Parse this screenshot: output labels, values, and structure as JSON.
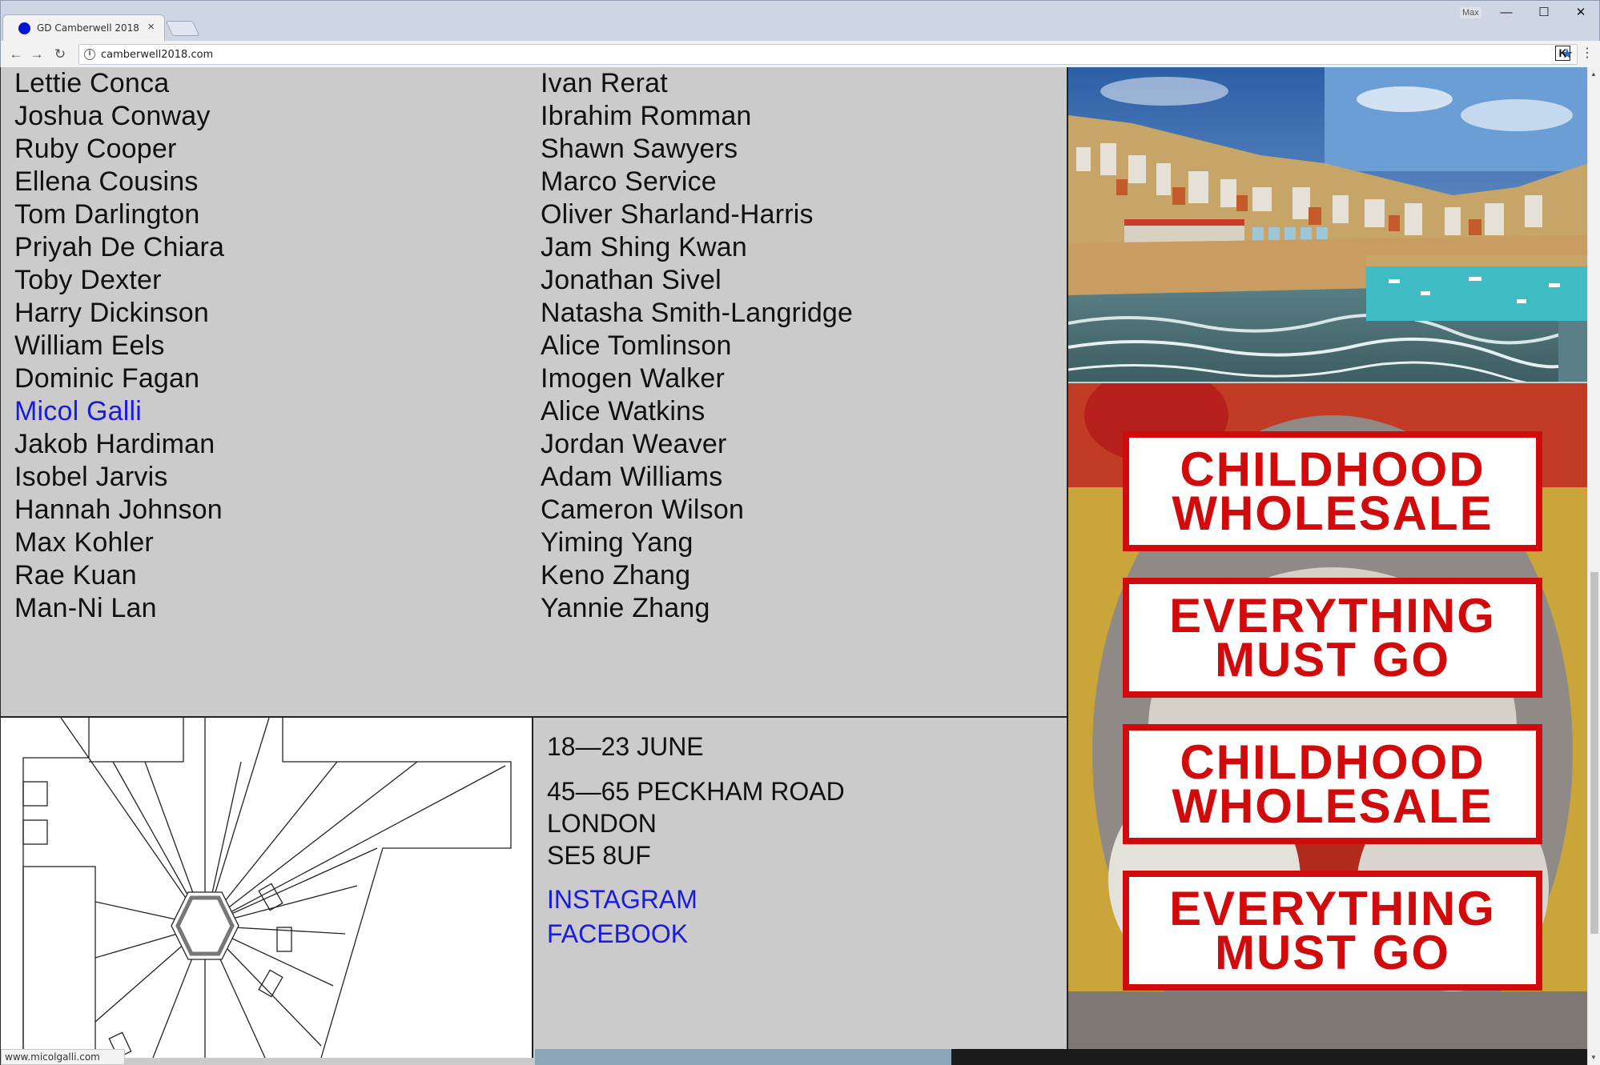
{
  "browser": {
    "tab_title": "GD Camberwell 2018",
    "tab_close": "×",
    "user_label": "Max",
    "url": "camberwell2018.com",
    "status_url": "www.micolgalli.com",
    "minimize": "—",
    "maximize": "☐",
    "close": "✕"
  },
  "students": {
    "column1": [
      {
        "name": "Lettie Conca"
      },
      {
        "name": "Joshua Conway"
      },
      {
        "name": "Ruby Cooper"
      },
      {
        "name": "Ellena Cousins"
      },
      {
        "name": "Tom Darlington"
      },
      {
        "name": "Priyah De Chiara"
      },
      {
        "name": "Toby Dexter"
      },
      {
        "name": "Harry Dickinson"
      },
      {
        "name": "William Eels"
      },
      {
        "name": "Dominic Fagan"
      },
      {
        "name": "Micol Galli"
      },
      {
        "name": "Jakob Hardiman"
      },
      {
        "name": "Isobel Jarvis"
      },
      {
        "name": "Hannah Johnson"
      },
      {
        "name": "Max Kohler"
      },
      {
        "name": "Rae Kuan"
      },
      {
        "name": "Man-Ni Lan"
      }
    ],
    "column2": [
      {
        "name": "Ivan Rerat"
      },
      {
        "name": "Ibrahim Romman"
      },
      {
        "name": "Shawn Sawyers"
      },
      {
        "name": "Marco Service"
      },
      {
        "name": "Oliver Sharland-Harris"
      },
      {
        "name": "Jam Shing Kwan"
      },
      {
        "name": "Jonathan Sivel"
      },
      {
        "name": "Natasha Smith-Langridge"
      },
      {
        "name": "Alice Tomlinson"
      },
      {
        "name": "Imogen Walker"
      },
      {
        "name": "Alice Watkins"
      },
      {
        "name": "Jordan Weaver"
      },
      {
        "name": "Adam Williams"
      },
      {
        "name": "Cameron Wilson"
      },
      {
        "name": "Yiming Yang"
      },
      {
        "name": "Keno Zhang"
      },
      {
        "name": "Yannie Zhang"
      }
    ],
    "hovered_name": "Micol Galli"
  },
  "event": {
    "dates": "18—23 JUNE",
    "address_line1": "45—65 PECKHAM ROAD",
    "address_line2": "LONDON",
    "address_line3": "SE5 8UF",
    "instagram": "INSTAGRAM",
    "facebook": "FACEBOOK"
  },
  "poster": {
    "sign1_line1": "CHILDHOOD",
    "sign1_line2": "WHOLESALE",
    "sign2_line1": "EVERYTHING",
    "sign2_line2": "MUST GO",
    "sign3_line1": "CHILDHOOD",
    "sign3_line2": "WHOLESALE",
    "sign4_line1": "EVERYTHING",
    "sign4_line2": "MUST GO"
  },
  "colors": {
    "page_bg": "#cbcbcb",
    "link": "#1a1ae0",
    "sign_red": "#d10b0b",
    "favicon": "#0015d6"
  }
}
